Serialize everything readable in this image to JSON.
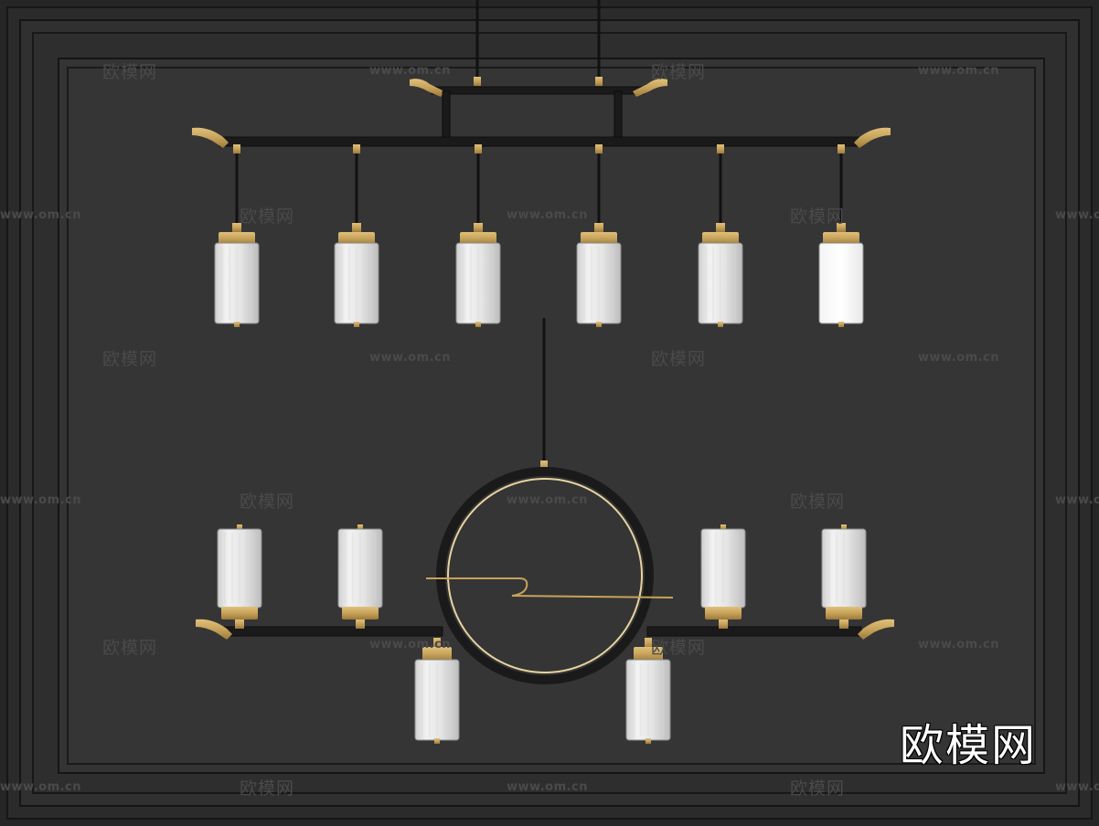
{
  "watermark": {
    "text": "欧模网",
    "url": "www.om.cn"
  },
  "logo": {
    "text": "欧模网"
  },
  "colors": {
    "background": "#2f2f2f",
    "frame_dark": "#1e1e1e",
    "frame_mid": "#3a3a3a",
    "bar": "#1a1a1a",
    "brass": "#c7a25a",
    "shade": "#e6e6e6",
    "watermark": "#4a4a4a"
  },
  "scene": {
    "upper_pendant_count": 6,
    "lower_left_pendant_count": 2,
    "lower_right_pendant_count": 2,
    "ring_pendant_count": 2
  }
}
